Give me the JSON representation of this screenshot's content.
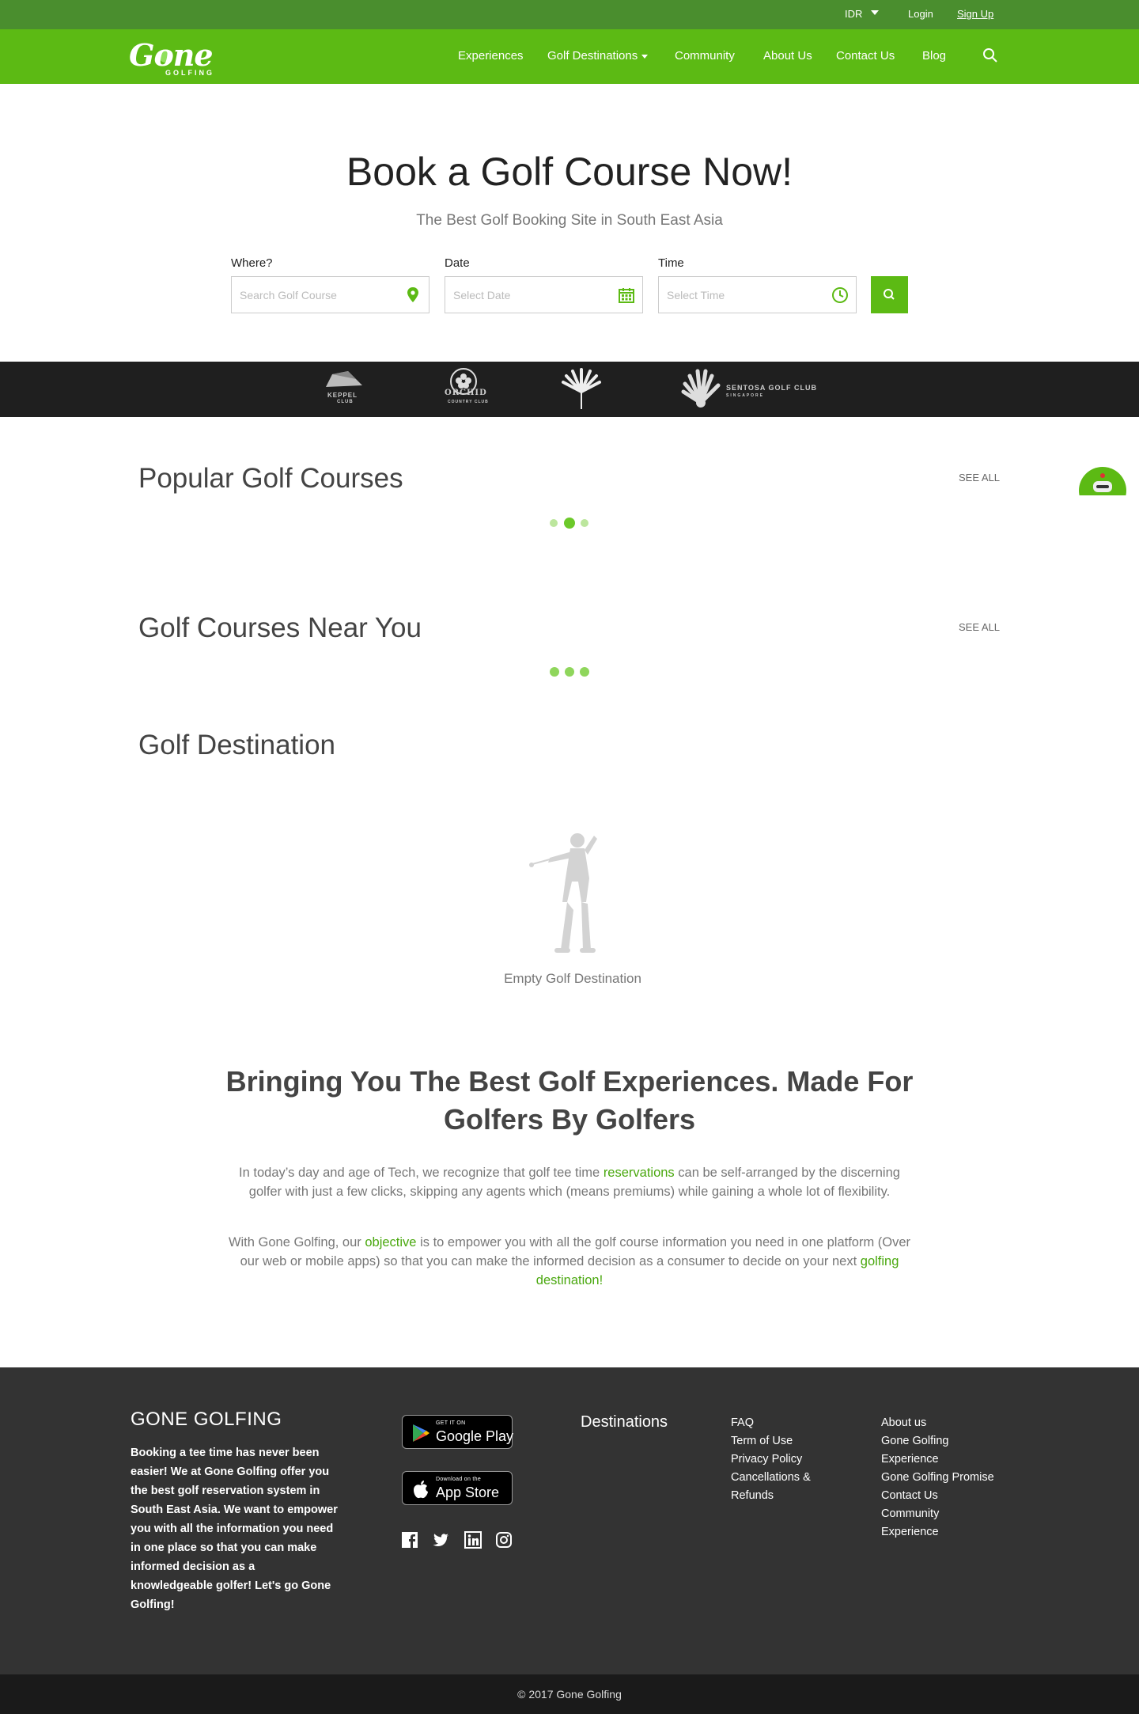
{
  "topbar": {
    "currency": "IDR",
    "login": "Login",
    "signup": "Sign Up"
  },
  "brand": {
    "logo_word": "Gone",
    "logo_sub": "GOLFING"
  },
  "nav": {
    "experiences": "Experiences",
    "destinations": "Golf Destinations",
    "community": "Community",
    "about": "About Us",
    "contact": "Contact Us",
    "blog": "Blog"
  },
  "hero": {
    "title": "Book a Golf Course Now!",
    "subtitle": "The Best Golf Booking Site in South East Asia",
    "where_label": "Where?",
    "where_placeholder": "Search Golf Course",
    "date_label": "Date",
    "date_placeholder": "Select Date",
    "time_label": "Time",
    "time_placeholder": "Select Time"
  },
  "partners": {
    "keppel": "KEPPEL",
    "keppel_sub": "CLUB",
    "orchid": "ORCHID",
    "orchid_sub": "COUNTRY CLUB",
    "sentosa": "SENTOSA GOLF CLUB",
    "sentosa_sub": "SINGAPORE"
  },
  "popular": {
    "title": "Popular Golf Courses",
    "see_all": "SEE ALL"
  },
  "nearby": {
    "title": "Golf Courses Near You",
    "see_all": "SEE ALL"
  },
  "destination": {
    "title": "Golf Destination",
    "empty_text": "Empty Golf Destination"
  },
  "about": {
    "title": "Bringing You The Best Golf Experiences. Made For Golfers By Golfers",
    "p1_a": "In today’s day and age of Tech, we recognize that golf tee time ",
    "p1_link": "reservations",
    "p1_b": " can be self-arranged by the discerning golfer with just a few clicks, skipping any agents which (means premiums) while gaining a whole lot of flexibility.",
    "p2_a": "With Gone Golfing, our ",
    "p2_link1": "objective",
    "p2_b": " is to empower you with all the golf course information you need in one platform (Over our web or mobile apps) so that you can make the informed decision as a consumer to decide on your next ",
    "p2_link2": "golfing destination!"
  },
  "footer": {
    "brand": "GONE GOLFING",
    "description": "Booking a tee time has never been easier! We at Gone Golfing offer you the best golf reservation system in South East Asia. We want to empower you with all the information you need in one place so that you can make informed decision as a knowledgeable golfer! Let's go Gone Golfing!",
    "google_small": "GET IT ON",
    "google_big": "Google Play",
    "apple_small": "Download on the",
    "apple_big": "App Store",
    "destinations": "Destinations",
    "col1": [
      "FAQ",
      "Term of Use",
      "Privacy Policy",
      "Cancellations &",
      "Refunds"
    ],
    "col2": [
      "About us",
      "Gone Golfing",
      "Experience",
      "Gone Golfing Promise",
      "Contact Us",
      "Community",
      "Experience"
    ]
  },
  "copyright": "© 2017 Gone Golfing",
  "colors": {
    "brand_green": "#5cba14",
    "topbar_green": "#4a8e2e",
    "footer_bg": "#333333",
    "partners_bg": "#1f1f1f"
  },
  "icons": [
    "search-icon",
    "location-pin-icon",
    "calendar-icon",
    "clock-icon",
    "facebook-icon",
    "twitter-icon",
    "linkedin-icon",
    "instagram-icon",
    "google-play-icon",
    "apple-icon",
    "golfer-icon",
    "chat-bot-icon"
  ]
}
